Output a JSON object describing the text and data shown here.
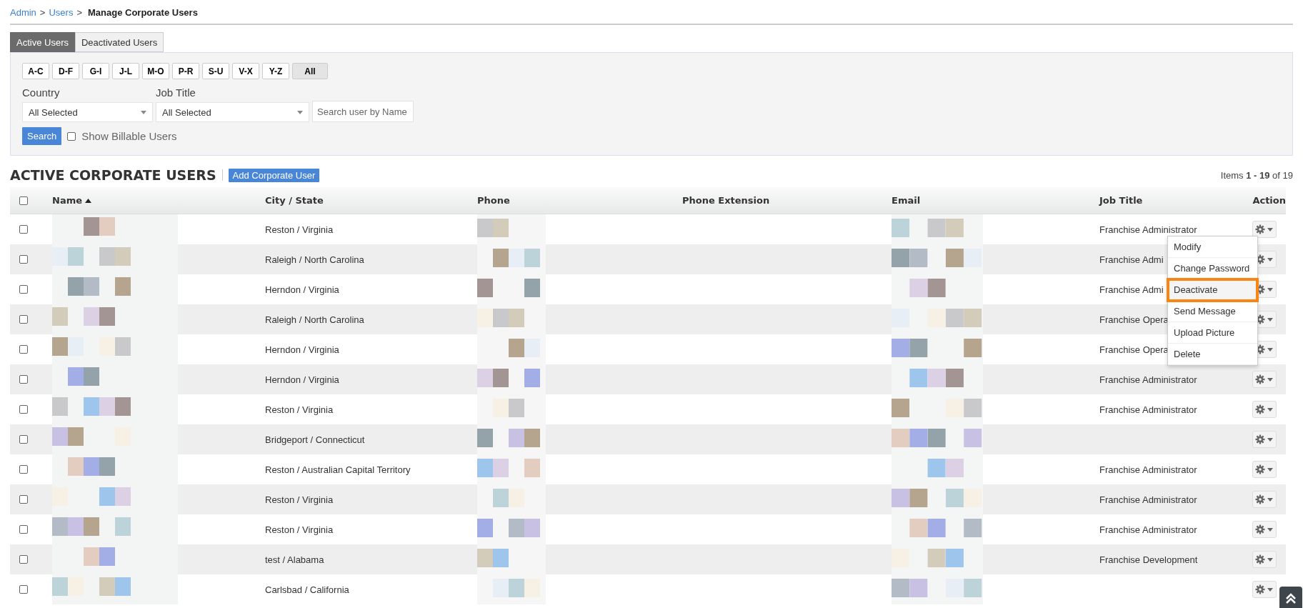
{
  "breadcrumb": [
    {
      "label": "Admin",
      "link": true,
      "separator": ">"
    },
    {
      "label": "Users",
      "link": true,
      "separator": ">"
    },
    {
      "label": "Manage Corporate Users",
      "link": false
    }
  ],
  "tabs": [
    {
      "label": "Active Users",
      "selected": true
    },
    {
      "label": "Deactivated Users",
      "selected": false
    }
  ],
  "letter_filters": [
    {
      "label": "A-C",
      "selected": false
    },
    {
      "label": "D-F",
      "selected": false
    },
    {
      "label": "G-I",
      "selected": false
    },
    {
      "label": "J-L",
      "selected": false
    },
    {
      "label": "M-O",
      "selected": false
    },
    {
      "label": "P-R",
      "selected": false
    },
    {
      "label": "S-U",
      "selected": false
    },
    {
      "label": "V-X",
      "selected": false
    },
    {
      "label": "Y-Z",
      "selected": false
    },
    {
      "label": "All",
      "selected": true
    }
  ],
  "filters": {
    "country": {
      "label": "Country",
      "value": "All Selected"
    },
    "job_title": {
      "label": "Job Title",
      "value": "All Selected"
    },
    "search": {
      "placeholder": "Search user by Name"
    },
    "search_button": "Search",
    "billable": {
      "label": "Show Billable Users",
      "checked": false
    }
  },
  "section": {
    "title": "ACTIVE CORPORATE USERS",
    "add_button": "Add Corporate User",
    "items_prefix": "Items",
    "items_range": "1 - 19",
    "items_suffix": "of 19"
  },
  "table": {
    "select_all_checked": false,
    "columns": [
      {
        "label": "Name",
        "sorted": true
      },
      {
        "label": "City / State",
        "sorted": false
      },
      {
        "label": "Phone",
        "sorted": false
      },
      {
        "label": "Phone Extension",
        "sorted": false
      },
      {
        "label": "Email",
        "sorted": false
      },
      {
        "label": "Job Title",
        "sorted": false
      },
      {
        "label": "Action",
        "sorted": false
      }
    ],
    "rows": [
      {
        "checked": false,
        "city": "Reston / Virginia",
        "job_title": "Franchise Administrator"
      },
      {
        "checked": false,
        "city": "Raleigh / North Carolina",
        "job_title": "Franchise Admi"
      },
      {
        "checked": false,
        "city": "Herndon / Virginia",
        "job_title": "Franchise Admi"
      },
      {
        "checked": false,
        "city": "Raleigh / North Carolina",
        "job_title": "Franchise Opera"
      },
      {
        "checked": false,
        "city": "Herndon / Virginia",
        "job_title": "Franchise Opera"
      },
      {
        "checked": false,
        "city": "Herndon / Virginia",
        "job_title": "Franchise Administrator"
      },
      {
        "checked": false,
        "city": "Reston / Virginia",
        "job_title": "Franchise Administrator"
      },
      {
        "checked": false,
        "city": "Bridgeport / Connecticut"
      },
      {
        "checked": false,
        "city": "Reston / Australian Capital Territory",
        "job_title": "Franchise Administrator"
      },
      {
        "checked": false,
        "city": "Reston / Virginia",
        "job_title": "Franchise Administrator"
      },
      {
        "checked": false,
        "city": "Reston / Virginia",
        "job_title": "Franchise Administrator"
      },
      {
        "checked": false,
        "city": "test / Alabama",
        "job_title": "Franchise Development"
      },
      {
        "checked": false,
        "city": "Carlsbad / California"
      }
    ]
  },
  "action_menu": {
    "items": [
      {
        "label": "Modify",
        "highlighted": false
      },
      {
        "label": "Change Password",
        "highlighted": false
      },
      {
        "label": "Deactivate",
        "highlighted": true
      },
      {
        "label": "Send Message",
        "highlighted": false
      },
      {
        "label": "Upload Picture",
        "highlighted": false
      },
      {
        "label": "Delete",
        "highlighted": false
      }
    ]
  }
}
